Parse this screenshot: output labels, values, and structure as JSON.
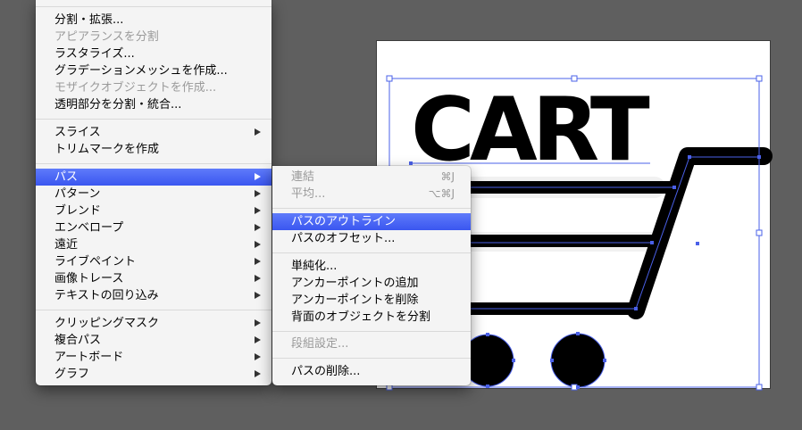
{
  "colors": {
    "desktop": "#5f5f5f",
    "menu_bg": "#f4f4f4",
    "highlight": "#3a56f0",
    "disabled_text": "#9a9a9a",
    "selection": "#4a60e8",
    "art": "#000000"
  },
  "artwork": {
    "title_text": "CART"
  },
  "object_menu": {
    "items": [
      {
        "label": "分割・拡張...",
        "enabled": true
      },
      {
        "label": "アピアランスを分割",
        "enabled": false
      },
      {
        "label": "ラスタライズ...",
        "enabled": true
      },
      {
        "label": "グラデーションメッシュを作成...",
        "enabled": true
      },
      {
        "label": "モザイクオブジェクトを作成...",
        "enabled": false
      },
      {
        "label": "透明部分を分割・統合...",
        "enabled": true
      },
      {
        "label": "スライス",
        "enabled": true,
        "submenu": true
      },
      {
        "label": "トリムマークを作成",
        "enabled": true
      },
      {
        "label": "パス",
        "enabled": true,
        "submenu": true,
        "highlighted": true
      },
      {
        "label": "パターン",
        "enabled": true,
        "submenu": true
      },
      {
        "label": "ブレンド",
        "enabled": true,
        "submenu": true
      },
      {
        "label": "エンベロープ",
        "enabled": true,
        "submenu": true
      },
      {
        "label": "遠近",
        "enabled": true,
        "submenu": true
      },
      {
        "label": "ライブペイント",
        "enabled": true,
        "submenu": true
      },
      {
        "label": "画像トレース",
        "enabled": true,
        "submenu": true
      },
      {
        "label": "テキストの回り込み",
        "enabled": true,
        "submenu": true
      },
      {
        "label": "クリッピングマスク",
        "enabled": true,
        "submenu": true
      },
      {
        "label": "複合パス",
        "enabled": true,
        "submenu": true
      },
      {
        "label": "アートボード",
        "enabled": true,
        "submenu": true
      },
      {
        "label": "グラフ",
        "enabled": true,
        "submenu": true
      }
    ]
  },
  "path_submenu": {
    "items": [
      {
        "label": "連結",
        "shortcut": "⌘J",
        "enabled": false
      },
      {
        "label": "平均...",
        "shortcut": "⌥⌘J",
        "enabled": false
      },
      {
        "label": "パスのアウトライン",
        "enabled": true,
        "highlighted": true
      },
      {
        "label": "パスのオフセット...",
        "enabled": true
      },
      {
        "label": "単純化...",
        "enabled": true
      },
      {
        "label": "アンカーポイントの追加",
        "enabled": true
      },
      {
        "label": "アンカーポイントを削除",
        "enabled": true
      },
      {
        "label": "背面のオブジェクトを分割",
        "enabled": true
      },
      {
        "label": "段組設定...",
        "enabled": false
      },
      {
        "label": "パスの削除...",
        "enabled": true
      }
    ]
  }
}
